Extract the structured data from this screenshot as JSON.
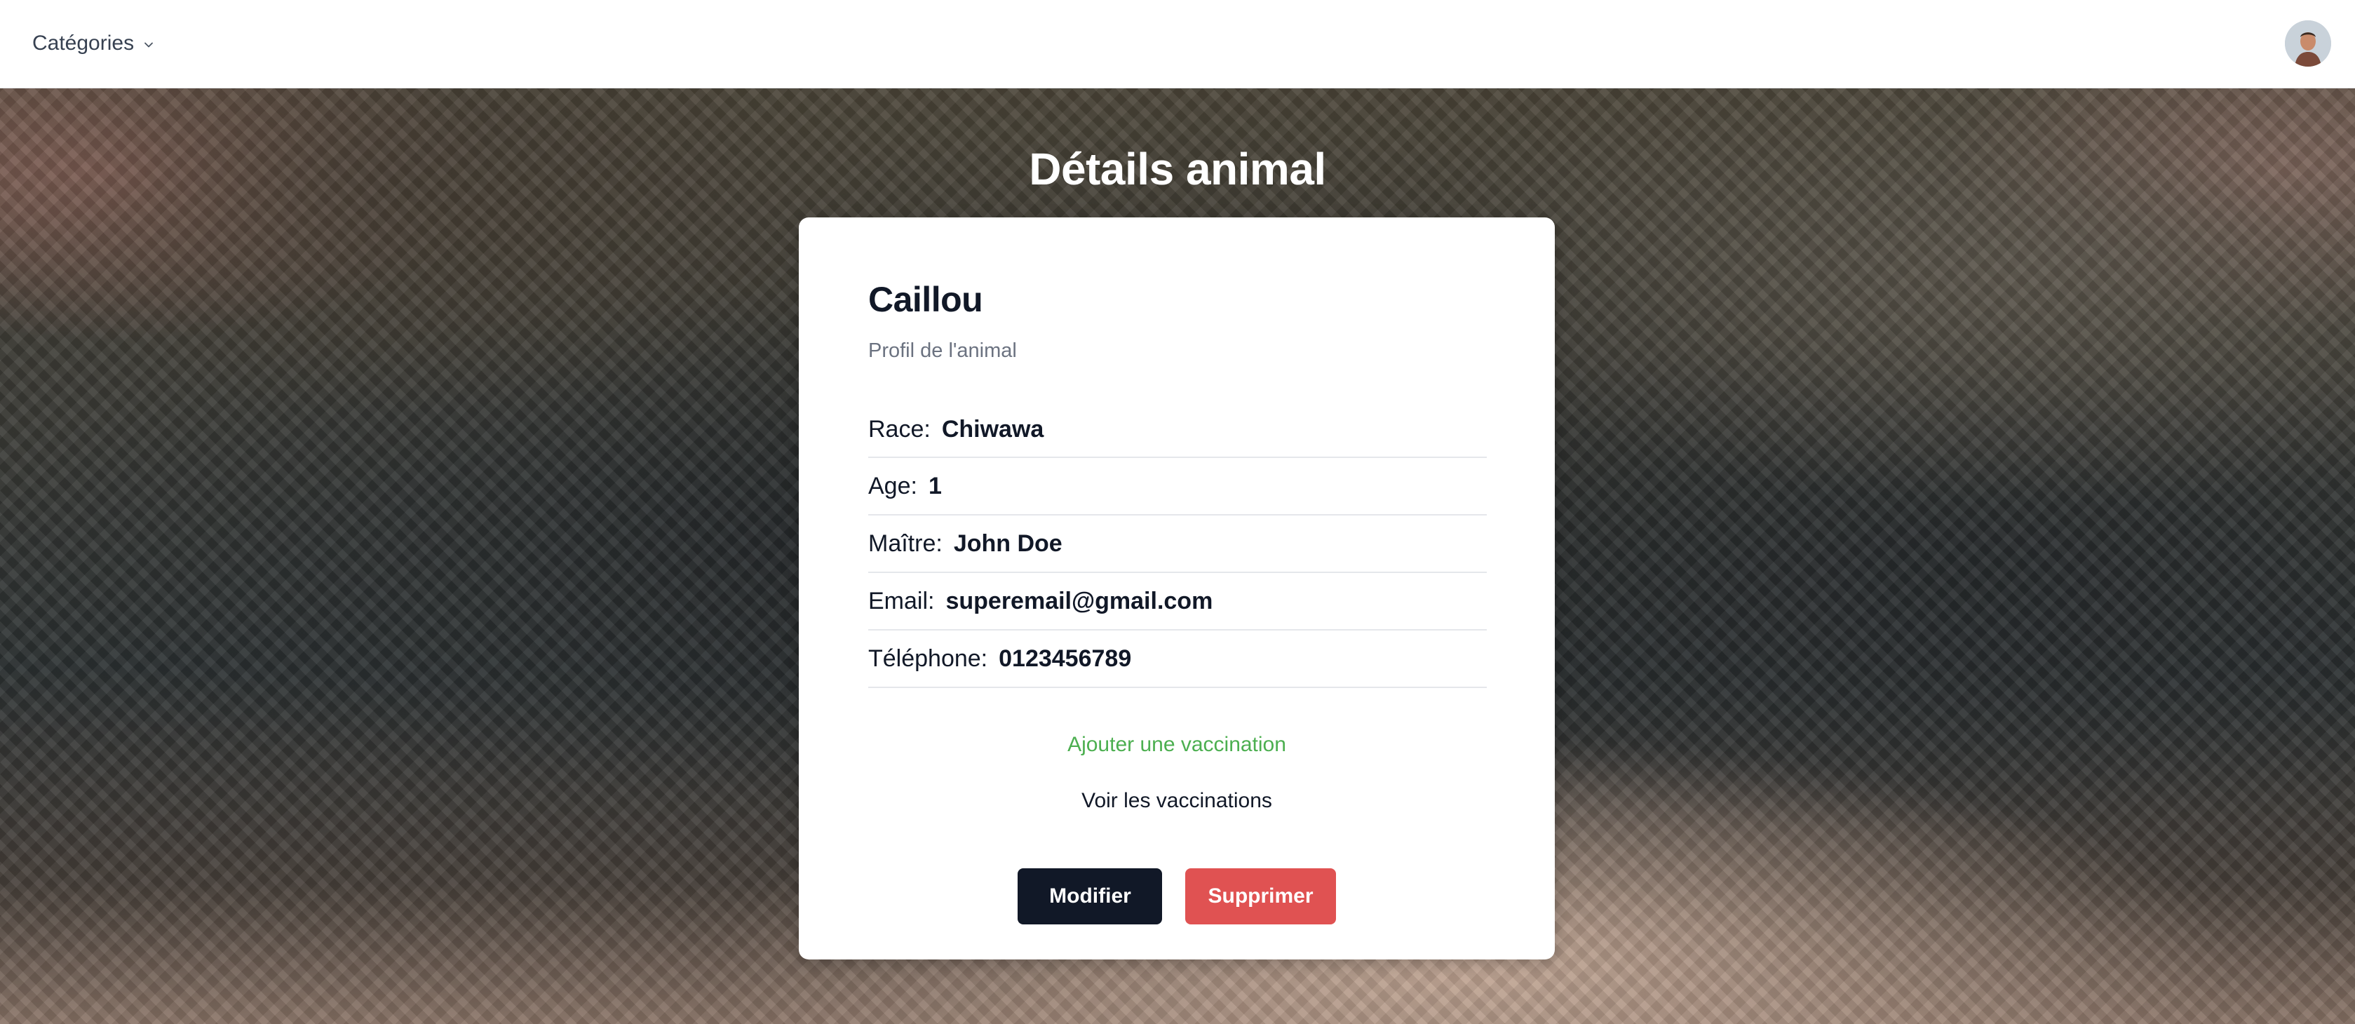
{
  "navbar": {
    "menu_label": "Catégories",
    "menu_icon": "chevron-down-icon",
    "avatar_icon": "user-avatar"
  },
  "page": {
    "title": "Détails animal"
  },
  "animal": {
    "name": "Caillou",
    "subtitle": "Profil de l'animal",
    "details": [
      {
        "label": "Race:",
        "value": "Chiwawa"
      },
      {
        "label": "Age:",
        "value": "1"
      },
      {
        "label": "Maître:",
        "value": "John Doe"
      },
      {
        "label": "Email:",
        "value": "superemail@gmail.com"
      },
      {
        "label": "Téléphone:",
        "value": "0123456789"
      }
    ]
  },
  "links": {
    "add_vaccination": "Ajouter une vaccination",
    "view_vaccinations": "Voir les vaccinations"
  },
  "actions": {
    "edit_label": "Modifier",
    "delete_label": "Supprimer"
  },
  "colors": {
    "add_link": "#4caf50",
    "edit_button": "#111827",
    "delete_button": "#e05252"
  }
}
